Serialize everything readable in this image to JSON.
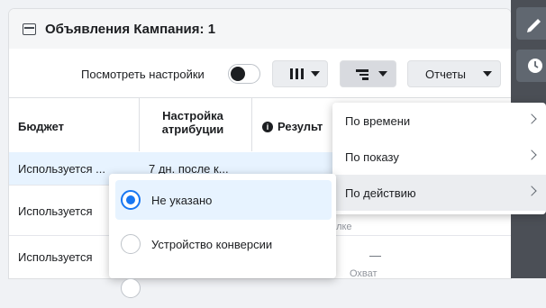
{
  "header": {
    "title": "Объявления Кампания: 1"
  },
  "toolbar": {
    "view_settings_label": "Посмотреть настройки",
    "reports_label": "Отчеты",
    "icons": {
      "columns": "columns-icon",
      "breakdown": "breakdown-icon"
    }
  },
  "table": {
    "headers": {
      "budget": "Бюджет",
      "attribution": "Настройка атрибуции",
      "results": "Результ"
    },
    "rows": [
      {
        "budget": "Используется ...",
        "attribution": "7 дн. после к...",
        "results": ""
      },
      {
        "budget": "Используется",
        "results_sub": "о ссылке"
      },
      {
        "budget": "Используется",
        "results": "—",
        "results_sub": "Охват"
      }
    ]
  },
  "breakdown_menu": {
    "items": [
      {
        "label": "По времени"
      },
      {
        "label": "По показу"
      },
      {
        "label": "По действию"
      }
    ]
  },
  "attribution_dropdown": {
    "options": [
      {
        "label": "Не указано",
        "selected": true
      },
      {
        "label": "Устройство конверсии",
        "selected": false
      }
    ]
  },
  "colors": {
    "accent": "#1877f2",
    "highlight": "#e7f3ff",
    "sidebar": "#4b4f56"
  }
}
